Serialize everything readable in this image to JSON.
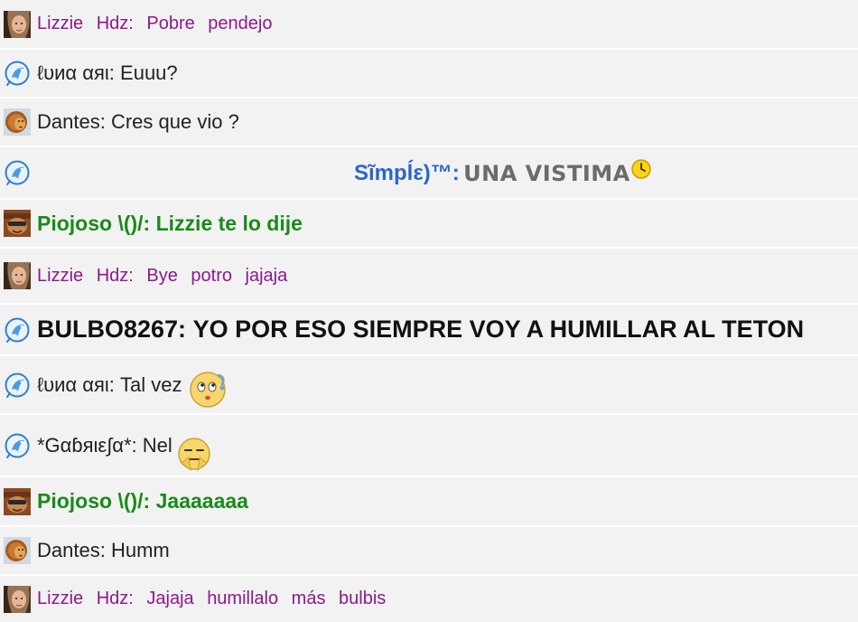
{
  "messages": [
    {
      "sender": "Lizzie  Hdz:",
      "text": "Pobre  pendejo",
      "avatar": "lizzie-avatar"
    },
    {
      "sender": "ℓυиα αяι:",
      "text": "Euuu?",
      "avatar": "msn-bird-icon"
    },
    {
      "sender": "Dantes:",
      "text": "Cres que vio ?",
      "avatar": "dantes-avatar"
    },
    {
      "sender": "Sĩmpĺε)™:",
      "text": "UNA VISTIMA",
      "avatar": "msn-bird-icon",
      "emoticon": "clock-emoticon"
    },
    {
      "sender": "Piojoso \\()/:",
      "text": "Lizzie te lo dije",
      "avatar": "piojoso-avatar"
    },
    {
      "sender": "Lizzie  Hdz:",
      "text": "Bye  potro  jajaja",
      "avatar": "lizzie-avatar"
    },
    {
      "sender": "BULBO8267:",
      "text": "YO POR ESO SIEMPRE VOY A HUMILLAR AL TETON",
      "avatar": "msn-bird-icon"
    },
    {
      "sender": "ℓυиα αяι:",
      "text": "Tal vez",
      "avatar": "msn-bird-icon",
      "emoticon": "thinking-emoticon"
    },
    {
      "sender": "*Gαɓяιε∫α*:",
      "text": "Nel",
      "avatar": "msn-bird-icon",
      "emoticon": "annoyed-emoticon"
    },
    {
      "sender": "Piojoso \\()/:",
      "text": "Jaaaaaaa",
      "avatar": "piojoso-avatar"
    },
    {
      "sender": "Dantes:",
      "text": "Humm",
      "avatar": "dantes-avatar"
    },
    {
      "sender": "Lizzie  Hdz:",
      "text": "Jajaja  humillalo  más  bulbis",
      "avatar": "lizzie-avatar"
    }
  ],
  "colors": {
    "row_bg": "#f2f2f2",
    "lizzie": "#8b1a8b",
    "piojoso": "#1a8a1a",
    "simple_sender": "#2b66c8",
    "simple_text": "#6b6b6b",
    "plain": "#222222"
  }
}
